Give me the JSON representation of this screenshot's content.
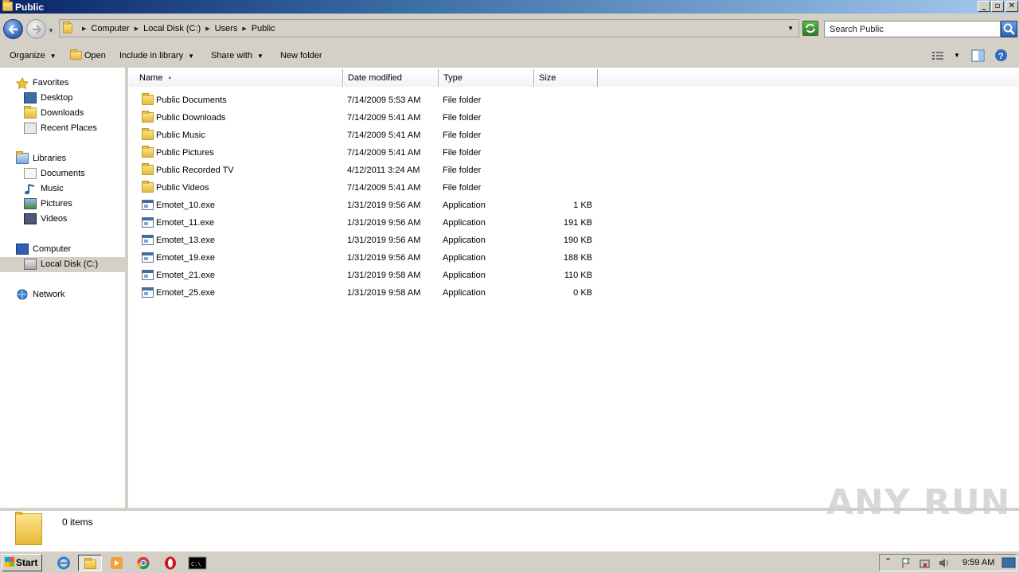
{
  "window": {
    "title": "Public"
  },
  "address": {
    "crumbs": [
      "Computer",
      "Local Disk (C:)",
      "Users",
      "Public"
    ],
    "search_placeholder": "Search Public"
  },
  "toolbar": {
    "organize": "Organize",
    "open": "Open",
    "include_in_library": "Include in library",
    "share_with": "Share with",
    "new_folder": "New folder"
  },
  "nav": {
    "favorites": "Favorites",
    "desktop": "Desktop",
    "downloads": "Downloads",
    "recent_places": "Recent Places",
    "libraries": "Libraries",
    "documents": "Documents",
    "music": "Music",
    "pictures": "Pictures",
    "videos": "Videos",
    "computer": "Computer",
    "local_disk": "Local Disk (C:)",
    "network": "Network"
  },
  "columns": {
    "name": "Name",
    "date_modified": "Date modified",
    "type": "Type",
    "size": "Size"
  },
  "files": [
    {
      "name": "Public Documents",
      "date": "7/14/2009 5:53 AM",
      "type": "File folder",
      "size": "",
      "kind": "folder"
    },
    {
      "name": "Public Downloads",
      "date": "7/14/2009 5:41 AM",
      "type": "File folder",
      "size": "",
      "kind": "folder"
    },
    {
      "name": "Public Music",
      "date": "7/14/2009 5:41 AM",
      "type": "File folder",
      "size": "",
      "kind": "folder"
    },
    {
      "name": "Public Pictures",
      "date": "7/14/2009 5:41 AM",
      "type": "File folder",
      "size": "",
      "kind": "folder"
    },
    {
      "name": "Public Recorded TV",
      "date": "4/12/2011 3:24 AM",
      "type": "File folder",
      "size": "",
      "kind": "folder"
    },
    {
      "name": "Public Videos",
      "date": "7/14/2009 5:41 AM",
      "type": "File folder",
      "size": "",
      "kind": "folder"
    },
    {
      "name": "Emotet_10.exe",
      "date": "1/31/2019 9:56 AM",
      "type": "Application",
      "size": "1 KB",
      "kind": "app"
    },
    {
      "name": "Emotet_11.exe",
      "date": "1/31/2019 9:56 AM",
      "type": "Application",
      "size": "191 KB",
      "kind": "app"
    },
    {
      "name": "Emotet_13.exe",
      "date": "1/31/2019 9:56 AM",
      "type": "Application",
      "size": "190 KB",
      "kind": "app"
    },
    {
      "name": "Emotet_19.exe",
      "date": "1/31/2019 9:56 AM",
      "type": "Application",
      "size": "188 KB",
      "kind": "app"
    },
    {
      "name": "Emotet_21.exe",
      "date": "1/31/2019 9:58 AM",
      "type": "Application",
      "size": "110 KB",
      "kind": "app"
    },
    {
      "name": "Emotet_25.exe",
      "date": "1/31/2019 9:58 AM",
      "type": "Application",
      "size": "0 KB",
      "kind": "app"
    }
  ],
  "details": {
    "count": "0 items"
  },
  "watermark": "ANY RUN",
  "taskbar": {
    "start": "Start",
    "clock": "9:59 AM"
  }
}
